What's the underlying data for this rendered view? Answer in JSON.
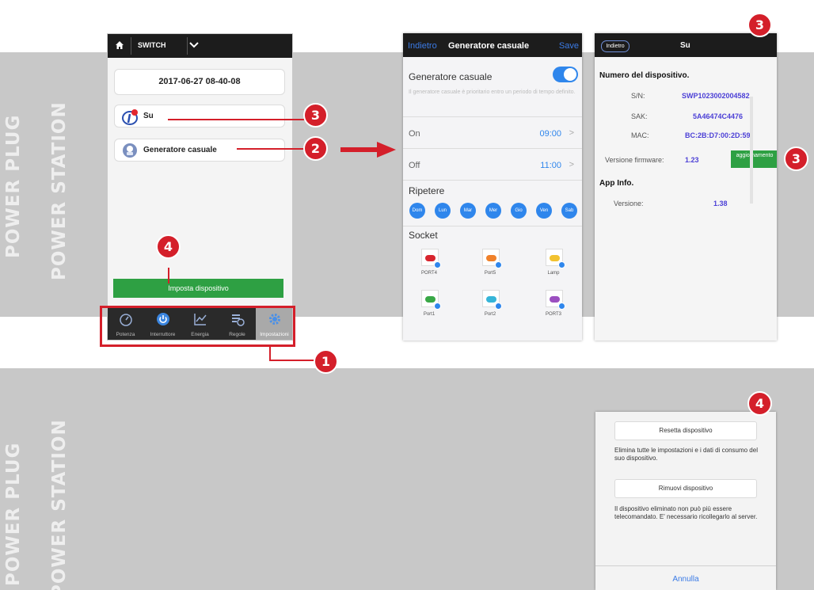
{
  "bands": {
    "top_label_1": "POWER PLUG",
    "top_label_2": "POWER STATION",
    "bottom_label_1": "POWER PLUG",
    "bottom_label_2": "POWER STATION",
    "color": "#c8c8c8"
  },
  "screen_switch": {
    "device": "SWITCH",
    "date": "2017-06-27 08-40-08",
    "items": [
      {
        "label": "Su",
        "icon": "info-badge-icon"
      },
      {
        "label": "Generatore casuale",
        "icon": "random-generator-icon"
      }
    ],
    "settings_button": "Imposta dispositivo",
    "tabs": [
      {
        "label": "Potenza",
        "icon": "gauge-icon"
      },
      {
        "label": "Interruttore",
        "icon": "power-icon"
      },
      {
        "label": "Energia",
        "icon": "chart-line-icon"
      },
      {
        "label": "Regole",
        "icon": "rules-icon"
      },
      {
        "label": "Impostazioni",
        "icon": "gear-icon",
        "active": true
      }
    ]
  },
  "screen_random": {
    "back": "Indietro",
    "title": "Generatore casuale",
    "save": "Save",
    "toggle_label": "Generatore casuale",
    "toggle_on": true,
    "description": "Il generatore casuale è prioritario entro un periodo di tempo definito.",
    "on_label": "On",
    "on_time": "09:00",
    "off_label": "Off",
    "off_time": "11:00",
    "repeat_label": "Ripetere",
    "days": [
      "Dom",
      "Lun",
      "Mar",
      "Mer",
      "Gio",
      "Ven",
      "Sab"
    ],
    "socket_label": "Socket",
    "sockets": [
      {
        "name": "PORT4",
        "color": "#d8252e"
      },
      {
        "name": "Port5",
        "color": "#f0812a"
      },
      {
        "name": "Lamp",
        "color": "#f2c230"
      },
      {
        "name": "Port1",
        "color": "#39a846"
      },
      {
        "name": "Port2",
        "color": "#36b5d8"
      },
      {
        "name": "PORT3",
        "color": "#9b4fc0"
      }
    ]
  },
  "screen_about": {
    "back": "Indietro",
    "title": "Su",
    "device_section": "Numero del dispositivo.",
    "sn_label": "S/N:",
    "sn": "SWP1023002004582",
    "sak_label": "SAK:",
    "sak": "5A46474C4476",
    "mac_label": "MAC:",
    "mac": "BC:2B:D7:00:2D:59",
    "fw_label": "Versione firmware:",
    "fw": "1.23",
    "update": "aggiornamento",
    "app_section": "App Info.",
    "ver_label": "Versione:",
    "ver": "1.38"
  },
  "screen_reset": {
    "reset": "Resetta dispositivo",
    "reset_note": "Elimina tutte le impostazioni e i dati di consumo del suo dispositivo.",
    "remove": "Rimuovi dispositivo",
    "remove_note": "Il dispositivo eliminato non può più essere telecomandato. E' necessario ricollegarlo al server.",
    "cancel": "Annulla"
  },
  "callouts": {
    "one": "1",
    "two": "2",
    "three_a": "3",
    "three_b": "3",
    "three_c": "3",
    "four_a": "4",
    "four_b": "4"
  },
  "colors": {
    "accent_red": "#d41f2a",
    "ios_blue": "#2f86ec",
    "green": "#2ea043"
  }
}
